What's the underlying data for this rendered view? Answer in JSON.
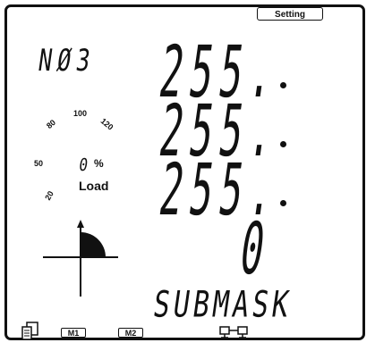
{
  "setting_label": "Setting",
  "code": "NØ3",
  "rows": [
    "255.",
    "255.",
    "255.",
    "0"
  ],
  "bottom_label": "SUBMASK",
  "load": {
    "scale": [
      "50",
      "80",
      "100",
      "120",
      "20"
    ],
    "percent_value": "0",
    "percent_unit": "%",
    "label": "Load"
  },
  "indicators": {
    "m1": "M1",
    "m2": "M2"
  },
  "icons": {
    "quadrant": "quadrant-indicator-icon",
    "device": "device-icon",
    "network": "network-link-icon"
  }
}
